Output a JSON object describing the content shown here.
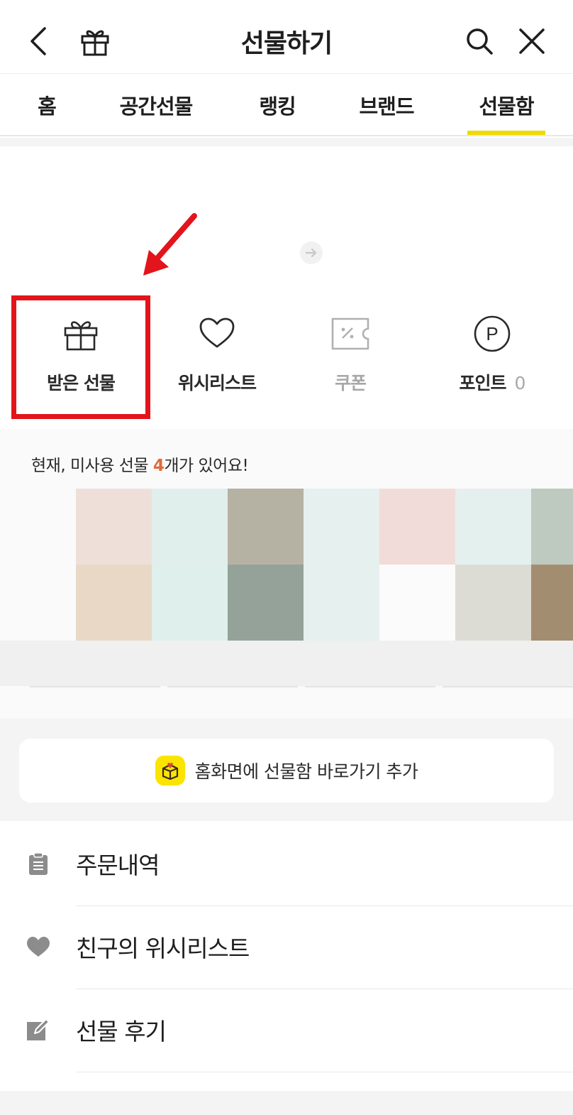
{
  "header": {
    "title": "선물하기",
    "back_icon": "chevron-left-icon",
    "gift_icon": "gift-icon",
    "search_icon": "search-icon",
    "close_icon": "close-icon"
  },
  "tabs": [
    {
      "label": "홈"
    },
    {
      "label": "공간선물"
    },
    {
      "label": "랭킹"
    },
    {
      "label": "브랜드"
    },
    {
      "label": "선물함",
      "active": true
    }
  ],
  "colors": {
    "accent_yellow": "#f2d900",
    "annotation_red": "#e3141b",
    "count_orange": "#e06a3a"
  },
  "quick_menu": [
    {
      "label": "받은 선물",
      "icon": "gift-box-icon",
      "highlighted": true
    },
    {
      "label": "위시리스트",
      "icon": "heart-icon"
    },
    {
      "label": "쿠폰",
      "icon": "coupon-icon"
    },
    {
      "label": "포인트",
      "icon": "point-icon",
      "count": "0"
    }
  ],
  "unused": {
    "prefix": "현재, 미사용 선물 ",
    "count": "4",
    "suffix": "개가 있어요!"
  },
  "gift_tiles": [
    "#eee0d8",
    "#e0eeec",
    "#b5b2a4",
    "#e6f0ee",
    "#f1dcd9",
    "#e4f0ee",
    "#bec9c0",
    "#ead8c6",
    "#dff0ec",
    "#95a299",
    "#e6f0ee",
    "#fbfbfb",
    "#dddcd4",
    "#a38d70"
  ],
  "shortcut": {
    "label": "홈화면에 선물함 바로가기 추가",
    "icon": "shortcut-box-icon"
  },
  "menu": [
    {
      "label": "주문내역",
      "icon": "clipboard-icon"
    },
    {
      "label": "친구의 위시리스트",
      "icon": "heart-icon"
    },
    {
      "label": "선물 후기",
      "icon": "edit-icon"
    }
  ]
}
